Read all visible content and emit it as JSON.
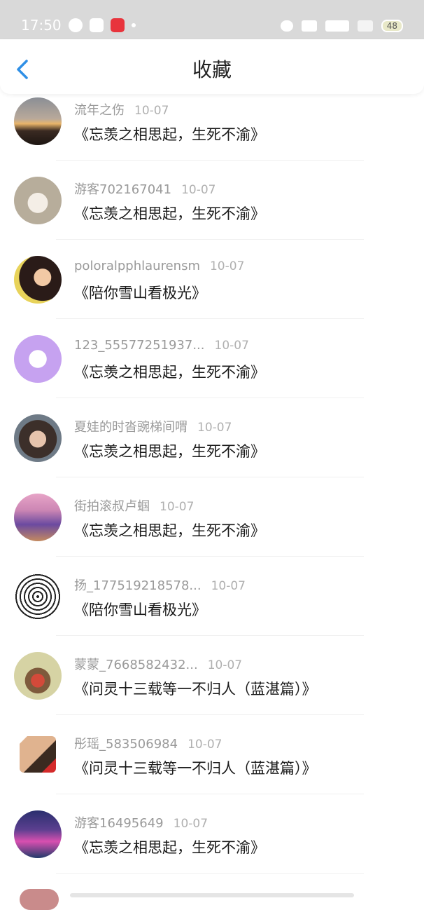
{
  "status_bar": {
    "time": "17:50",
    "battery": "48"
  },
  "header": {
    "title": "收藏"
  },
  "favorites": [
    {
      "user": "流年之伤",
      "date": "10-07",
      "work": "《忘羡之相思起，生死不渝》",
      "avatar": "sunset"
    },
    {
      "user": "游客702167041",
      "date": "10-07",
      "work": "《忘羡之相思起，生死不渝》",
      "avatar": "rabbit"
    },
    {
      "user": "poloralpphlaurensm",
      "date": "10-07",
      "work": "《陪你雪山看极光》",
      "avatar": "girl-portrait"
    },
    {
      "user": "123_55577251937...",
      "date": "10-07",
      "work": "《忘羡之相思起，生死不渝》",
      "avatar": "purple-chat"
    },
    {
      "user": "夏娃的时沓豌梯间喟",
      "date": "10-07",
      "work": "《忘羡之相思起，生死不渝》",
      "avatar": "boy-portrait"
    },
    {
      "user": "街拍滚叔卢蝈",
      "date": "10-07",
      "work": "《忘羡之相思起，生死不渝》",
      "avatar": "pink-sky-text"
    },
    {
      "user": "扬_177519218578...",
      "date": "10-07",
      "work": "《陪你雪山看极光》",
      "avatar": "pattern-bw"
    },
    {
      "user": "蒙蒙_7668582432...",
      "date": "10-07",
      "work": "《问灵十三载等一不归人（蓝湛篇）》",
      "avatar": "cartoon-couple"
    },
    {
      "user": "彤瑶_583506984",
      "date": "10-07",
      "work": "《问灵十三载等一不归人（蓝湛篇）》",
      "avatar": "flag-square"
    },
    {
      "user": "游客16495649",
      "date": "10-07",
      "work": "《忘羡之相思起，生死不渝》",
      "avatar": "city-night"
    }
  ],
  "colors": {
    "accent": "#2f8fe6",
    "title": "#222222",
    "meta": "#9a9a9a"
  }
}
